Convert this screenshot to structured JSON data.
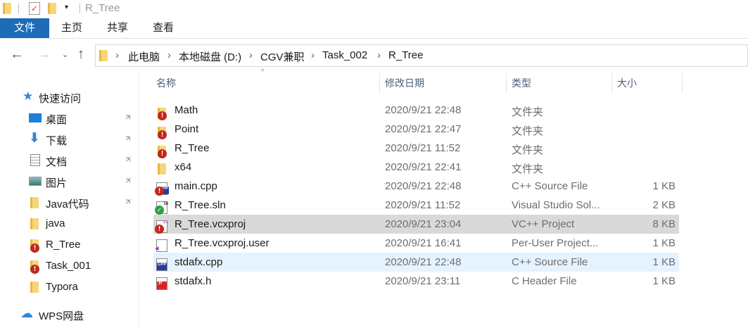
{
  "window": {
    "title": "R_Tree"
  },
  "ribbon": {
    "tabs": [
      {
        "label": "文件",
        "active": true
      },
      {
        "label": "主页"
      },
      {
        "label": "共享"
      },
      {
        "label": "查看"
      }
    ],
    "accent": "#1e6bb8"
  },
  "address": {
    "crumbs": [
      "此电脑",
      "本地磁盘 (D:)",
      "CGV兼职",
      "Task_002",
      "R_Tree"
    ]
  },
  "columns": {
    "name": "名称",
    "date": "修改日期",
    "type": "类型",
    "size": "大小"
  },
  "sidebar": {
    "quick_access": "快速访问",
    "items": [
      {
        "label": "桌面",
        "icon": "desktop-icon",
        "pinned": true
      },
      {
        "label": "下载",
        "icon": "download-icon",
        "pinned": true
      },
      {
        "label": "文档",
        "icon": "document-icon",
        "pinned": true
      },
      {
        "label": "图片",
        "icon": "pictures-icon",
        "pinned": true
      },
      {
        "label": "Java代码",
        "icon": "folder-icon",
        "pinned": true
      },
      {
        "label": "java",
        "icon": "folder-icon",
        "pinned": false
      },
      {
        "label": "R_Tree",
        "icon": "folder-warning-icon",
        "pinned": false
      },
      {
        "label": "Task_001",
        "icon": "folder-warning-icon",
        "pinned": false
      },
      {
        "label": "Typora",
        "icon": "folder-icon",
        "pinned": false
      }
    ],
    "wps": "WPS网盘"
  },
  "files": [
    {
      "name": "Math",
      "date": "2020/9/21 22:48",
      "type": "文件夹",
      "size": "",
      "icon": "folder-warning"
    },
    {
      "name": "Point",
      "date": "2020/9/21 22:47",
      "type": "文件夹",
      "size": "",
      "icon": "folder-warning"
    },
    {
      "name": "R_Tree",
      "date": "2020/9/21 11:52",
      "type": "文件夹",
      "size": "",
      "icon": "folder-warning"
    },
    {
      "name": "x64",
      "date": "2020/9/21 22:41",
      "type": "文件夹",
      "size": "",
      "icon": "folder"
    },
    {
      "name": "main.cpp",
      "date": "2020/9/21 22:48",
      "type": "C++ Source File",
      "size": "1 KB",
      "icon": "cpp-warning"
    },
    {
      "name": "R_Tree.sln",
      "date": "2020/9/21 11:52",
      "type": "Visual Studio Sol...",
      "size": "2 KB",
      "icon": "sln-ok"
    },
    {
      "name": "R_Tree.vcxproj",
      "date": "2020/9/21 23:04",
      "type": "VC++ Project",
      "size": "8 KB",
      "icon": "vcxproj-warning",
      "selected": true
    },
    {
      "name": "R_Tree.vcxproj.user",
      "date": "2020/9/21 16:41",
      "type": "Per-User Project...",
      "size": "1 KB",
      "icon": "vs-user"
    },
    {
      "name": "stdafx.cpp",
      "date": "2020/9/21 22:48",
      "type": "C++ Source File",
      "size": "1 KB",
      "icon": "cpp",
      "hover": true
    },
    {
      "name": "stdafx.h",
      "date": "2020/9/21 23:11",
      "type": "C Header File",
      "size": "1 KB",
      "icon": "header"
    }
  ]
}
